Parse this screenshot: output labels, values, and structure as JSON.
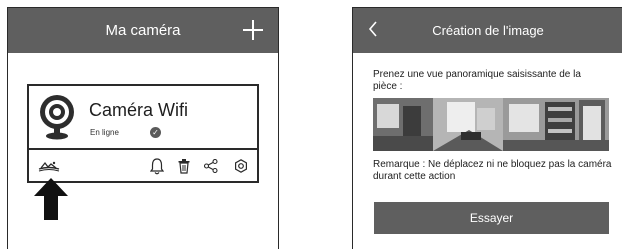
{
  "screen1": {
    "title": "Ma caméra",
    "add_icon": "plus-icon",
    "camera": {
      "name": "Caméra Wifi",
      "status": "En ligne",
      "status_icon": "check-icon"
    },
    "toolbar": {
      "icons": [
        "panorama-icon",
        "bell-icon",
        "trash-icon",
        "share-icon",
        "settings-icon"
      ]
    },
    "pointer_icon": "up-arrow-icon"
  },
  "screen2": {
    "title": "Création de l'image",
    "back_icon": "chevron-left-icon",
    "instruction": "Prenez une vue panoramique saisissante de la pièce :",
    "remark": "Remarque : Ne déplacez ni ne bloquez pas la caméra durant cette action",
    "button_label": "Essayer"
  },
  "colors": {
    "header_bg": "#5f5f5f",
    "button_bg": "#5f5f5f",
    "border": "#2a2a2a",
    "text": "#1e1e1e"
  }
}
